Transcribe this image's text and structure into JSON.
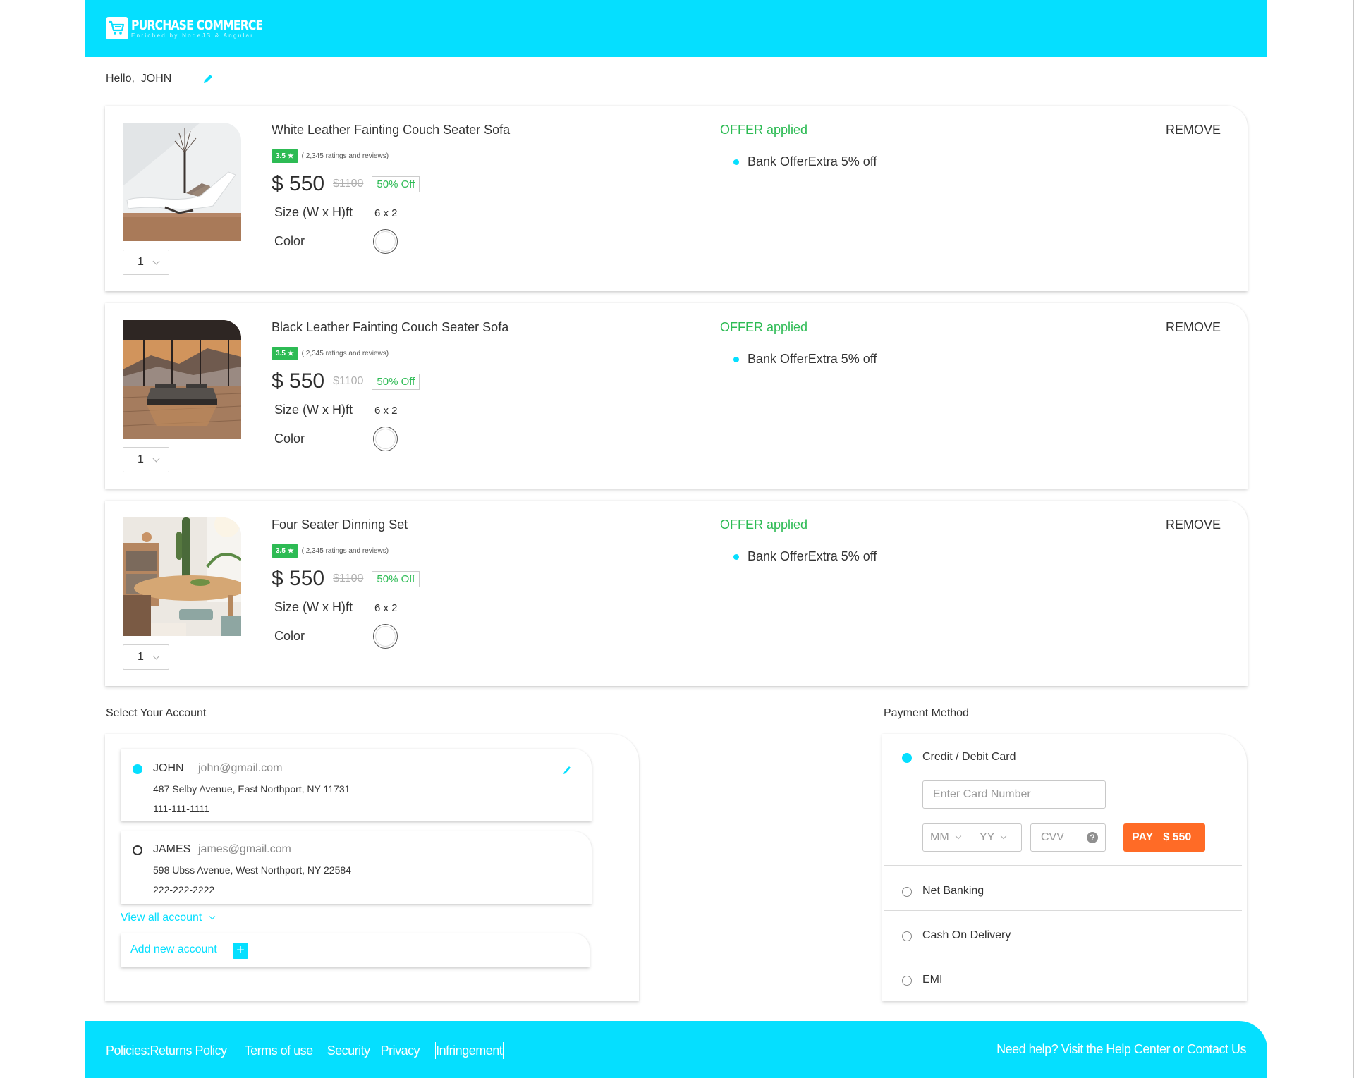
{
  "brand": {
    "title": "PURCHASE COMMERCE",
    "subtitle": "Enriched by NodeJS & Angular",
    "accent_color": "#05dfff"
  },
  "greeting": {
    "prefix": "Hello,",
    "name": "JOHN",
    "edit_icon": "pencil-icon"
  },
  "cart": {
    "items": [
      {
        "name": "White Leather Fainting Couch Seater Sofa",
        "rating": "3.5",
        "rating_icon": "star-icon",
        "rating_count": "( 2,345 ratings and reviews)",
        "price": "$ 550",
        "old_price": "$1100",
        "discount": "50% Off",
        "size_label": "Size (W x H)ft",
        "size_value": "6 x 2",
        "color_label": "Color",
        "quantity": "1",
        "offer_title": "OFFER applied",
        "offer_text": "Bank OfferExtra 5% off",
        "remove_label": "REMOVE",
        "image": "white-sofa-photo"
      },
      {
        "name": "Black Leather Fainting Couch Seater Sofa",
        "rating": "3.5",
        "rating_icon": "star-icon",
        "rating_count": "( 2,345 ratings and reviews)",
        "price": "$ 550",
        "old_price": "$1100",
        "discount": "50% Off",
        "size_label": "Size (W x H)ft",
        "size_value": "6 x 2",
        "color_label": "Color",
        "quantity": "1",
        "offer_title": "OFFER applied",
        "offer_text": "Bank OfferExtra 5% off",
        "remove_label": "REMOVE",
        "image": "black-bed-photo"
      },
      {
        "name": "Four Seater Dinning Set",
        "rating": "3.5",
        "rating_icon": "star-icon",
        "rating_count": "( 2,345 ratings and reviews)",
        "price": "$ 550",
        "old_price": "$1100",
        "discount": "50% Off",
        "size_label": "Size (W x H)ft",
        "size_value": "6 x 2",
        "color_label": "Color",
        "quantity": "1",
        "offer_title": "OFFER applied",
        "offer_text": "Bank OfferExtra 5% off",
        "remove_label": "REMOVE",
        "image": "dining-set-photo"
      }
    ]
  },
  "accounts": {
    "section_label": "Select Your Account",
    "list": [
      {
        "name": "JOHN",
        "email": "john@gmail.com",
        "address": "487 Selby Avenue, East Northport, NY 11731",
        "phone": "111-111-1111",
        "selected": true
      },
      {
        "name": "JAMES",
        "email": "james@gmail.com",
        "address": "598 Ubss Avenue, West Northport, NY 22584",
        "phone": "222-222-2222",
        "selected": false
      }
    ],
    "view_all_label": "View all account",
    "add_new_label": "Add new account",
    "add_icon": "+"
  },
  "payment": {
    "section_label": "Payment Method",
    "methods": [
      {
        "label": "Credit / Debit Card",
        "selected": true
      },
      {
        "label": "Net Banking",
        "selected": false
      },
      {
        "label": "Cash On Delivery",
        "selected": false
      },
      {
        "label": "EMI",
        "selected": false
      }
    ],
    "card_number_placeholder": "Enter Card Number",
    "month_placeholder": "MM",
    "year_placeholder": "YY",
    "cvv_placeholder": "CVV",
    "cvv_help": "?",
    "pay_label": "PAY",
    "pay_amount": "$ 550",
    "pay_color": "#ff6b26"
  },
  "footer": {
    "links": [
      "Policies:Returns Policy",
      "Terms of use",
      "Security",
      "Privacy",
      "Infringement"
    ],
    "help_text": "Need help? Visit the Help Center or Contact Us"
  }
}
